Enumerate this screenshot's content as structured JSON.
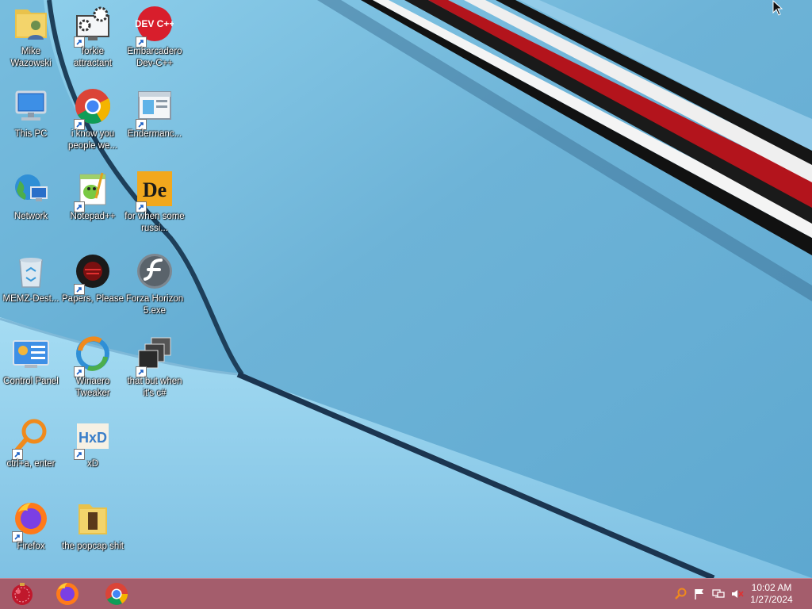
{
  "desktop": {
    "icons": [
      {
        "label": "Mike Wazowski",
        "icon": "user-folder-icon"
      },
      {
        "label": "forkie attractant",
        "icon": "settings-monitor-icon"
      },
      {
        "label": "Embarcadero Dev-C++",
        "icon": "dev-cpp-icon",
        "icon_text": "DEV C++"
      },
      {
        "label": "This PC",
        "icon": "computer-icon"
      },
      {
        "label": "i know you people we...",
        "icon": "chrome-icon"
      },
      {
        "label": "Endermanc...",
        "icon": "window-app-icon"
      },
      {
        "label": "Network",
        "icon": "network-globe-icon"
      },
      {
        "label": "Notepad++",
        "icon": "notepad-plus-plus-icon"
      },
      {
        "label": "for when some russi...",
        "icon": "de-app-icon",
        "icon_text": "De"
      },
      {
        "label": "MEMZ-Dest...",
        "icon": "recycle-bin-icon"
      },
      {
        "label": "Papers, Please",
        "icon": "papers-please-icon"
      },
      {
        "label": "Forza Horizon 5.exe",
        "icon": "flash-icon"
      },
      {
        "label": "Control Panel",
        "icon": "control-panel-icon"
      },
      {
        "label": "Winaero Tweaker",
        "icon": "winaero-tweaker-icon"
      },
      {
        "label": "that but when it's c#",
        "icon": "stacked-windows-icon"
      },
      {
        "label": "ctrl+a, enter",
        "icon": "search-icon"
      },
      {
        "label": "xD",
        "icon": "hxd-icon",
        "icon_text": "HxD"
      },
      {
        "label": "Firefox",
        "icon": "firefox-icon"
      },
      {
        "label": "the popcap shit",
        "icon": "folder-icon"
      }
    ]
  },
  "taskbar": {
    "start_icon": "start-orb-icon",
    "pinned": [
      {
        "name": "firefox",
        "icon": "firefox-icon"
      },
      {
        "name": "chrome",
        "icon": "chrome-icon"
      }
    ],
    "tray": [
      {
        "name": "search",
        "icon": "search-tray-icon"
      },
      {
        "name": "action-center",
        "icon": "flag-icon"
      },
      {
        "name": "network",
        "icon": "network-icon"
      },
      {
        "name": "volume",
        "icon": "volume-muted-icon"
      }
    ],
    "clock": {
      "time": "10:02 AM",
      "date": "1/27/2024"
    }
  },
  "colors": {
    "wallpaper_base": "#6fb3d6",
    "taskbar": "#a45d6c",
    "stripe_red": "#b3141c"
  }
}
